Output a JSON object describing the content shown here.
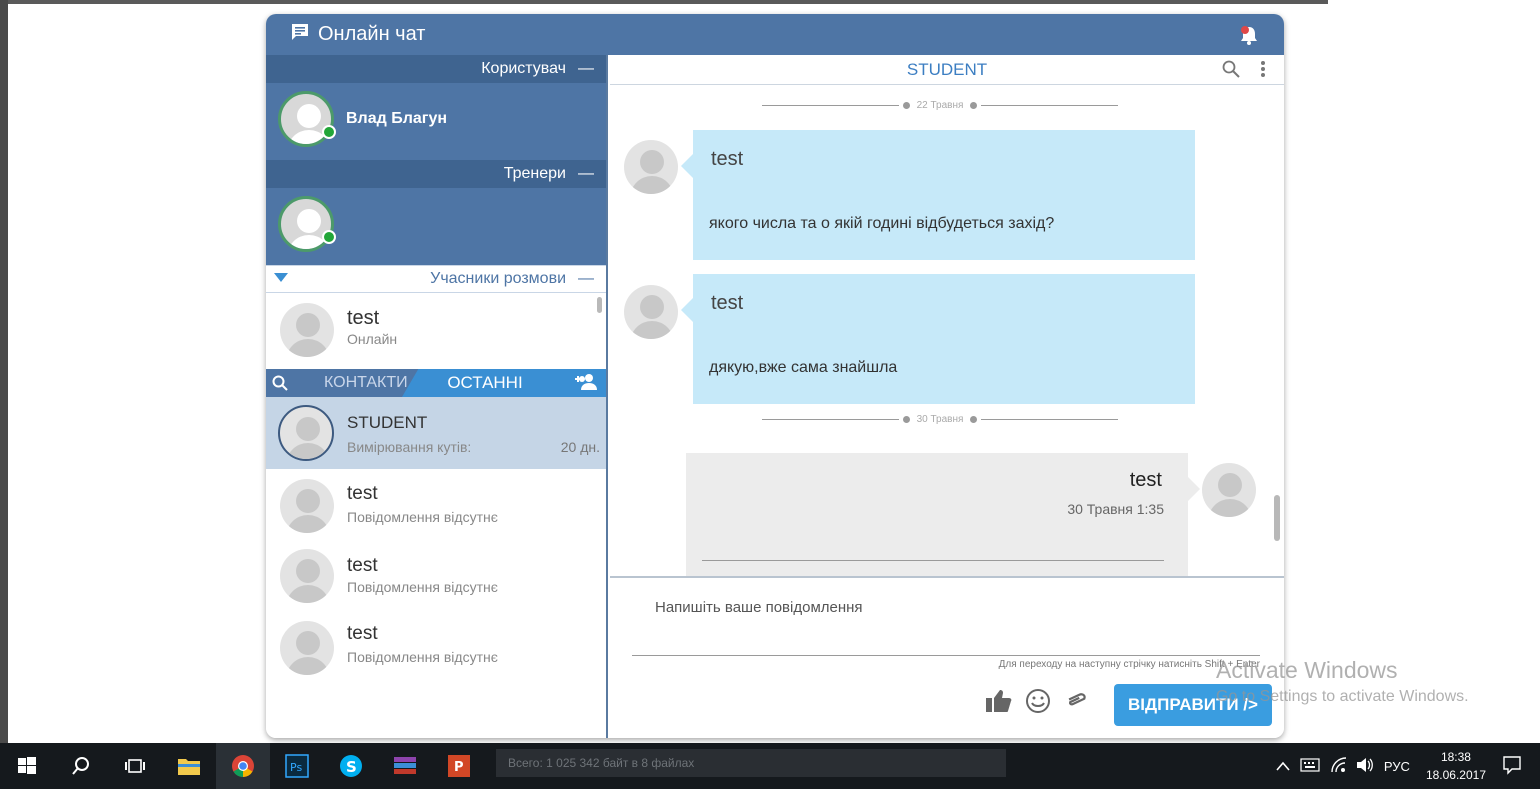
{
  "header": {
    "title": "Онлайн чат"
  },
  "left": {
    "user_section": "Користувач",
    "user_name": "Влад Благун",
    "trainers_section": "Тренери",
    "participants_section": "Учасники розмови",
    "section_collapse": "—",
    "participants": [
      {
        "name": "test",
        "status": "Онлайн"
      }
    ],
    "tabs": {
      "contacts": "КОНТАКТИ",
      "recent": "ОСТАННІ"
    },
    "contacts": [
      {
        "name": "STUDENT",
        "last": "Вимірювання кутів:",
        "time": "20 дн."
      },
      {
        "name": "test",
        "last": "Повідомлення відсутнє"
      },
      {
        "name": "test",
        "last": "Повідомлення відсутнє"
      },
      {
        "name": "test",
        "last": "Повідомлення відсутнє"
      }
    ]
  },
  "conversation": {
    "title": "STUDENT",
    "date1": "22 Травня",
    "messages": [
      {
        "sender": "test",
        "text": "якого числа та о якій годині відбудеться захід?"
      },
      {
        "sender": "test",
        "text": "дякую,вже сама знайшла"
      }
    ],
    "date2": "30 Травня",
    "outgoing": {
      "sender": "test",
      "time": "30 Травня 1:35"
    }
  },
  "compose": {
    "placeholder": "Напишіть ваше повідомлення",
    "hint": "Для переходу на наступну стрічку натисніть Shift + Enter",
    "send_label": "ВІДПРАВИТИ />"
  },
  "watermark": {
    "line1": "Activate Windows",
    "line2": "Go to Settings to activate Windows."
  },
  "taskbar": {
    "status_text": "Всего: 1 025 342 байт в 8 файлах",
    "lang": "РУС",
    "time": "18:38",
    "date": "18.06.2017"
  },
  "colors": {
    "header": "#4e75a5",
    "accent": "#3a9de0",
    "bubble_in": "#c6e9f9",
    "bubble_out": "#ececec",
    "online": "#22a638"
  }
}
